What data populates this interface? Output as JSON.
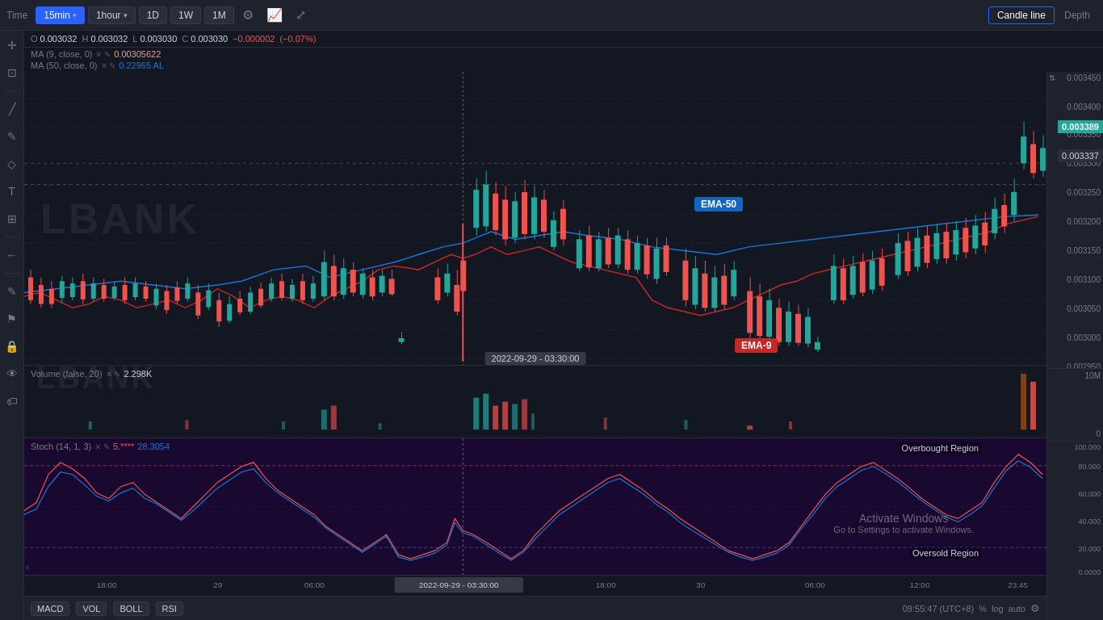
{
  "toolbar": {
    "time_label": "Time",
    "intervals": [
      {
        "label": "15min",
        "active": true,
        "has_arrow": true
      },
      {
        "label": "1hour",
        "active": false,
        "has_arrow": true
      },
      {
        "label": "1D",
        "active": false
      },
      {
        "label": "1W",
        "active": false
      },
      {
        "label": "1M",
        "active": false
      }
    ],
    "settings_icon": "⚙",
    "chart_icon": "📈",
    "fullscreen_icon": "⤢",
    "candle_line_label": "Candle line",
    "depth_label": "Depth"
  },
  "price_info": {
    "open_label": "O",
    "open_val": "0.003032",
    "high_label": "H",
    "high_val": "0.003032",
    "low_label": "L",
    "low_val": "0.003030",
    "close_label": "C",
    "close_val": "0.003030",
    "change_val": "-0.000002",
    "change_pct": "(-0.07%)",
    "ma9_label": "MA (9, close, 0)",
    "ma9_val": "0.00305622",
    "ma50_label": "MA (50, close, 0)",
    "ma50_val": "0.22965 AL"
  },
  "ema_labels": {
    "ema50": "EMA-50",
    "ema9": "EMA-9"
  },
  "price_scale": {
    "values": [
      "0.003450",
      "0.003400",
      "0.003350",
      "0.003300",
      "0.003250",
      "0.003200",
      "0.003150",
      "0.003100",
      "0.003050",
      "0.003000",
      "0.002950"
    ],
    "current_price": "0.003389",
    "dashed_price": "0.003337",
    "volume_scale": [
      "10M",
      "0"
    ],
    "stoch_scale": [
      "100.000",
      "80.000",
      "60.000",
      "40.000",
      "20.000",
      "0.0000"
    ]
  },
  "indicators": {
    "volume_label": "Volume (false, 20)",
    "volume_val": "2.298K",
    "stoch_label": "Stoch (14, 1, 3)",
    "stoch_k": "5.****",
    "stoch_d": "28.3054",
    "overbought_label": "Overbought Region",
    "oversold_label": "Oversold Region"
  },
  "bottom_bar": {
    "macd_label": "MACD",
    "vol_label": "VOL",
    "boll_label": "BOLL",
    "rsi_label": "RSI",
    "time_status": "09:55:47 (UTC+8)",
    "pct_label": "%",
    "log_label": "log",
    "auto_label": "auto",
    "settings_icon": "⚙"
  },
  "time_axis": {
    "labels": [
      "18:00",
      "29",
      "06:00",
      "2022-09-29 - 03:30:00",
      "18:00",
      "30",
      "06:00",
      "12:00",
      "23:45"
    ]
  },
  "sidebar_icons": [
    "✛",
    "□",
    "╱",
    "✎",
    "✦",
    "⊕",
    "←",
    "✎",
    "☞",
    "🔒",
    "👁",
    "🏷"
  ],
  "watermark": "LBANK",
  "activate_windows": {
    "line1": "Activate Windows",
    "line2": "Go to Settings to activate Windows."
  },
  "crosshair_date": "2022-09-29 - 03:30:00"
}
